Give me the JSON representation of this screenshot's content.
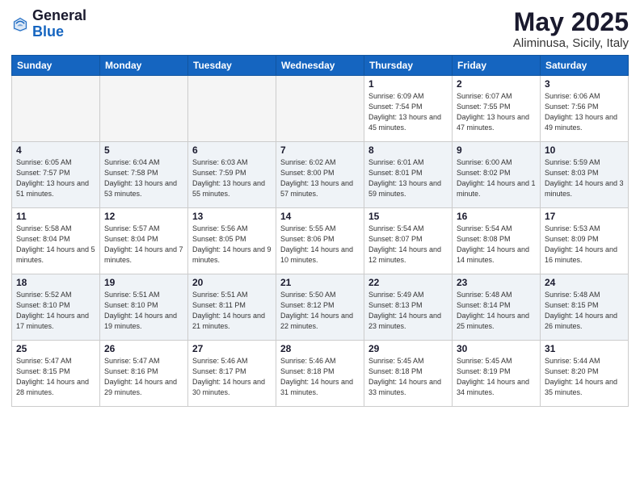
{
  "header": {
    "logo_general": "General",
    "logo_blue": "Blue",
    "month_title": "May 2025",
    "location": "Aliminusa, Sicily, Italy"
  },
  "weekdays": [
    "Sunday",
    "Monday",
    "Tuesday",
    "Wednesday",
    "Thursday",
    "Friday",
    "Saturday"
  ],
  "weeks": [
    [
      {
        "day": "",
        "empty": true
      },
      {
        "day": "",
        "empty": true
      },
      {
        "day": "",
        "empty": true
      },
      {
        "day": "",
        "empty": true
      },
      {
        "day": "1",
        "sunrise": "6:09 AM",
        "sunset": "7:54 PM",
        "daylight": "13 hours and 45 minutes."
      },
      {
        "day": "2",
        "sunrise": "6:07 AM",
        "sunset": "7:55 PM",
        "daylight": "13 hours and 47 minutes."
      },
      {
        "day": "3",
        "sunrise": "6:06 AM",
        "sunset": "7:56 PM",
        "daylight": "13 hours and 49 minutes."
      }
    ],
    [
      {
        "day": "4",
        "sunrise": "6:05 AM",
        "sunset": "7:57 PM",
        "daylight": "13 hours and 51 minutes."
      },
      {
        "day": "5",
        "sunrise": "6:04 AM",
        "sunset": "7:58 PM",
        "daylight": "13 hours and 53 minutes."
      },
      {
        "day": "6",
        "sunrise": "6:03 AM",
        "sunset": "7:59 PM",
        "daylight": "13 hours and 55 minutes."
      },
      {
        "day": "7",
        "sunrise": "6:02 AM",
        "sunset": "8:00 PM",
        "daylight": "13 hours and 57 minutes."
      },
      {
        "day": "8",
        "sunrise": "6:01 AM",
        "sunset": "8:01 PM",
        "daylight": "13 hours and 59 minutes."
      },
      {
        "day": "9",
        "sunrise": "6:00 AM",
        "sunset": "8:02 PM",
        "daylight": "14 hours and 1 minute."
      },
      {
        "day": "10",
        "sunrise": "5:59 AM",
        "sunset": "8:03 PM",
        "daylight": "14 hours and 3 minutes."
      }
    ],
    [
      {
        "day": "11",
        "sunrise": "5:58 AM",
        "sunset": "8:04 PM",
        "daylight": "14 hours and 5 minutes."
      },
      {
        "day": "12",
        "sunrise": "5:57 AM",
        "sunset": "8:04 PM",
        "daylight": "14 hours and 7 minutes."
      },
      {
        "day": "13",
        "sunrise": "5:56 AM",
        "sunset": "8:05 PM",
        "daylight": "14 hours and 9 minutes."
      },
      {
        "day": "14",
        "sunrise": "5:55 AM",
        "sunset": "8:06 PM",
        "daylight": "14 hours and 10 minutes."
      },
      {
        "day": "15",
        "sunrise": "5:54 AM",
        "sunset": "8:07 PM",
        "daylight": "14 hours and 12 minutes."
      },
      {
        "day": "16",
        "sunrise": "5:54 AM",
        "sunset": "8:08 PM",
        "daylight": "14 hours and 14 minutes."
      },
      {
        "day": "17",
        "sunrise": "5:53 AM",
        "sunset": "8:09 PM",
        "daylight": "14 hours and 16 minutes."
      }
    ],
    [
      {
        "day": "18",
        "sunrise": "5:52 AM",
        "sunset": "8:10 PM",
        "daylight": "14 hours and 17 minutes."
      },
      {
        "day": "19",
        "sunrise": "5:51 AM",
        "sunset": "8:10 PM",
        "daylight": "14 hours and 19 minutes."
      },
      {
        "day": "20",
        "sunrise": "5:51 AM",
        "sunset": "8:11 PM",
        "daylight": "14 hours and 21 minutes."
      },
      {
        "day": "21",
        "sunrise": "5:50 AM",
        "sunset": "8:12 PM",
        "daylight": "14 hours and 22 minutes."
      },
      {
        "day": "22",
        "sunrise": "5:49 AM",
        "sunset": "8:13 PM",
        "daylight": "14 hours and 23 minutes."
      },
      {
        "day": "23",
        "sunrise": "5:48 AM",
        "sunset": "8:14 PM",
        "daylight": "14 hours and 25 minutes."
      },
      {
        "day": "24",
        "sunrise": "5:48 AM",
        "sunset": "8:15 PM",
        "daylight": "14 hours and 26 minutes."
      }
    ],
    [
      {
        "day": "25",
        "sunrise": "5:47 AM",
        "sunset": "8:15 PM",
        "daylight": "14 hours and 28 minutes."
      },
      {
        "day": "26",
        "sunrise": "5:47 AM",
        "sunset": "8:16 PM",
        "daylight": "14 hours and 29 minutes."
      },
      {
        "day": "27",
        "sunrise": "5:46 AM",
        "sunset": "8:17 PM",
        "daylight": "14 hours and 30 minutes."
      },
      {
        "day": "28",
        "sunrise": "5:46 AM",
        "sunset": "8:18 PM",
        "daylight": "14 hours and 31 minutes."
      },
      {
        "day": "29",
        "sunrise": "5:45 AM",
        "sunset": "8:18 PM",
        "daylight": "14 hours and 33 minutes."
      },
      {
        "day": "30",
        "sunrise": "5:45 AM",
        "sunset": "8:19 PM",
        "daylight": "14 hours and 34 minutes."
      },
      {
        "day": "31",
        "sunrise": "5:44 AM",
        "sunset": "8:20 PM",
        "daylight": "14 hours and 35 minutes."
      }
    ]
  ],
  "labels": {
    "sunrise_label": "Sunrise:",
    "sunset_label": "Sunset:",
    "daylight_label": "Daylight:"
  }
}
